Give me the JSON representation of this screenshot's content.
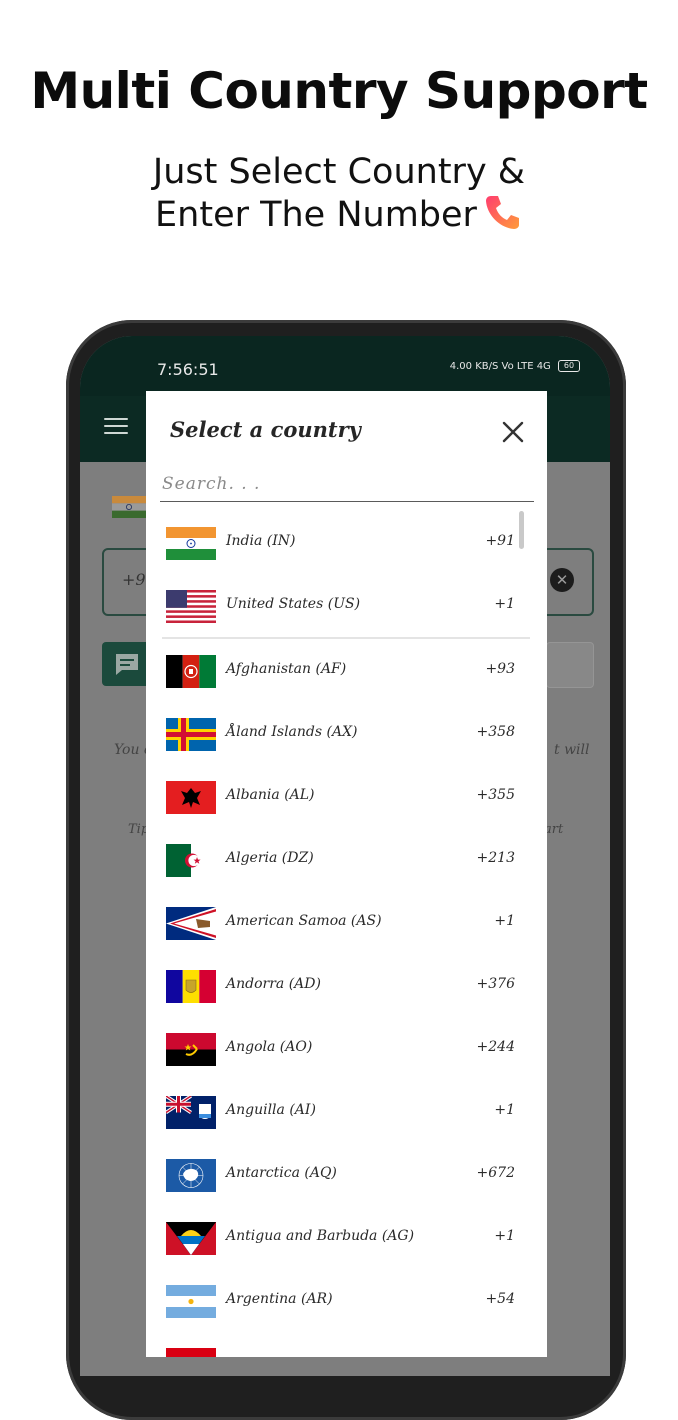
{
  "promo": {
    "headline": "Multi Country Support",
    "sub_line1": "Just Select Country &",
    "sub_line2": "Enter The Number"
  },
  "statusbar": {
    "time": "7:56:51",
    "net_speed": "4.00 KB/S",
    "icons": "Vo LTE 4G",
    "battery": "60"
  },
  "background": {
    "input_prefix": "+9",
    "line1_left": "You c",
    "line1_right": "t will",
    "line2_left": "Tip",
    "line2_right": "art"
  },
  "dialog": {
    "title": "Select a country",
    "search_placeholder": "Search. . .",
    "pinned": [
      {
        "name": "India (IN)",
        "code": "+91"
      },
      {
        "name": "United States (US)",
        "code": "+1"
      }
    ],
    "countries": [
      {
        "name": "Afghanistan (AF)",
        "code": "+93"
      },
      {
        "name": "Åland Islands (AX)",
        "code": "+358"
      },
      {
        "name": "Albania (AL)",
        "code": "+355"
      },
      {
        "name": "Algeria (DZ)",
        "code": "+213"
      },
      {
        "name": "American Samoa (AS)",
        "code": "+1"
      },
      {
        "name": "Andorra (AD)",
        "code": "+376"
      },
      {
        "name": "Angola (AO)",
        "code": "+244"
      },
      {
        "name": "Anguilla (AI)",
        "code": "+1"
      },
      {
        "name": "Antarctica (AQ)",
        "code": "+672"
      },
      {
        "name": "Antigua and Barbuda (AG)",
        "code": "+1"
      },
      {
        "name": "Argentina (AR)",
        "code": "+54"
      }
    ]
  },
  "colors": {
    "app_dark_green": "#0c2a23",
    "overlay_gray": "#7e7e7e",
    "dialog_bg": "#ffffff"
  }
}
